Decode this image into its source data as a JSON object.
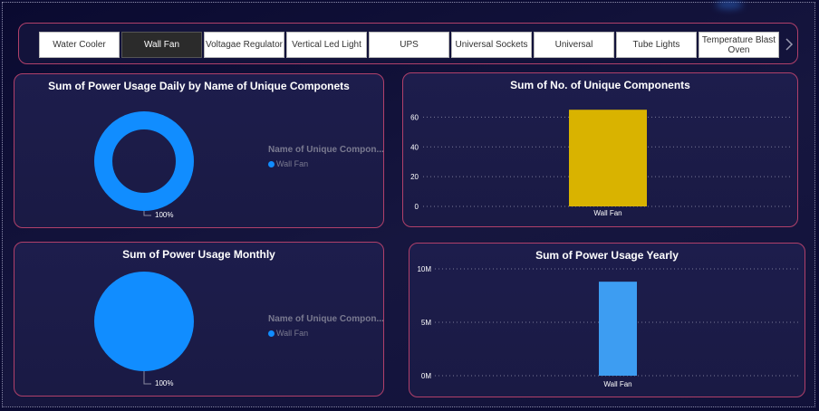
{
  "slicer": {
    "tiles": [
      "Water Cooler",
      "Wall Fan",
      "Voltagae Regulator",
      "Vertical Led Light",
      "UPS",
      "Universal Sockets",
      "Universal",
      "Tube Lights",
      "Temperature Blast Oven"
    ],
    "selected": "Wall Fan"
  },
  "colors": {
    "donut": "#118dff",
    "bar_count": "#d9b300",
    "bar_yearly": "#3d9df2",
    "card_border": "#b0406a"
  },
  "chart_data": [
    {
      "type": "pie",
      "variant": "donut",
      "title": "Sum of Power Usage Daily by Name of Unique Componets",
      "legend_title": "Name of Unique Compon...",
      "legend_position": "right",
      "slices": [
        {
          "label": "Wall Fan",
          "value": 100
        }
      ],
      "data_label": "100%"
    },
    {
      "type": "bar",
      "title": "Sum of No. of Unique Components",
      "categories": [
        "Wall Fan"
      ],
      "values": [
        65
      ],
      "yticks": [
        0,
        20,
        40,
        60
      ],
      "ylim": [
        0,
        70
      ],
      "grid": true
    },
    {
      "type": "pie",
      "title": "Sum of Power Usage Monthly",
      "legend_title": "Name of Unique Compon...",
      "legend_position": "right",
      "slices": [
        {
          "label": "Wall Fan",
          "value": 100
        }
      ],
      "data_label": "100%"
    },
    {
      "type": "bar",
      "title": "Sum of Power Usage Yearly",
      "categories": [
        "Wall Fan"
      ],
      "values": [
        8800000
      ],
      "yticks": [
        "0M",
        "5M",
        "10M"
      ],
      "ylim": [
        0,
        10000000
      ],
      "grid": true
    }
  ]
}
